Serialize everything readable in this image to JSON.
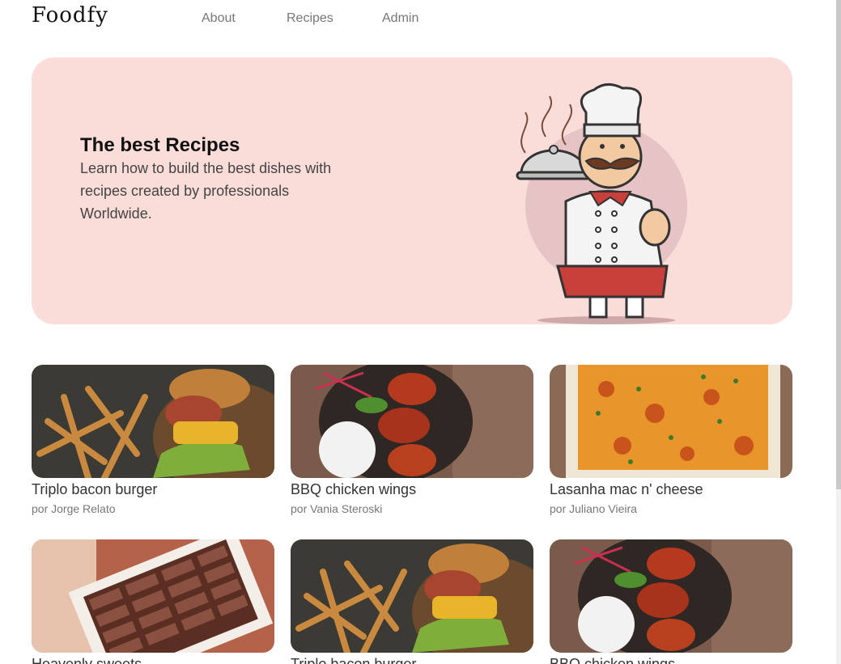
{
  "brand": "Foodfy",
  "nav": [
    "About",
    "Recipes",
    "Admin"
  ],
  "hero": {
    "title": "The best Recipes",
    "text": "Learn how to build the best dishes with recipes created by professionals Worldwide."
  },
  "recipes": [
    {
      "title": "Triplo bacon burger",
      "author": "por Jorge Relato",
      "image": "burger"
    },
    {
      "title": "BBQ chicken wings",
      "author": "por Vania Steroski",
      "image": "wings"
    },
    {
      "title": "Lasanha mac n' cheese",
      "author": "por Juliano Vieira",
      "image": "lasagna"
    },
    {
      "title": "Heavenly sweets",
      "author": "",
      "image": "chocolates"
    },
    {
      "title": "Triplo bacon burger",
      "author": "",
      "image": "burger"
    },
    {
      "title": "BBQ chicken wings",
      "author": "",
      "image": "wings"
    }
  ]
}
